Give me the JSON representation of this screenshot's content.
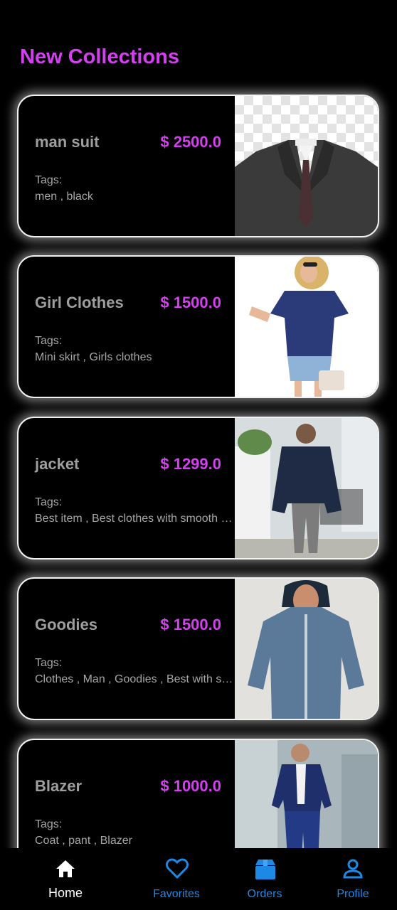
{
  "page": {
    "title": "New Collections",
    "accent_color": "#d43ff0",
    "nav_color": "#1e88e5"
  },
  "products": [
    {
      "name": "man suit",
      "price": "$ 2500.0",
      "tags_label": "Tags:",
      "tags": "men ,  black",
      "image": "suit-on-transparent-photo"
    },
    {
      "name": "Girl Clothes",
      "price": "$ 1500.0",
      "tags_label": "Tags:",
      "tags": "Mini skirt ,  Girls clothes",
      "image": "woman-blue-tee-photo"
    },
    {
      "name": "jacket",
      "price": "$ 1299.0",
      "tags_label": "Tags:",
      "tags": "Best item ,  Best clothes with smooth fabric",
      "image": "man-navy-jacket-photo"
    },
    {
      "name": "Goodies",
      "price": "$ 1500.0",
      "tags_label": "Tags:",
      "tags": "Clothes ,  Man ,  Goodies ,  Best with style",
      "image": "man-blue-hoodie-photo"
    },
    {
      "name": "Blazer",
      "price": "$ 1000.0",
      "tags_label": "Tags:",
      "tags": "Coat ,  pant ,  Blazer",
      "image": "man-blue-blazer-photo"
    }
  ],
  "nav": {
    "items": [
      {
        "label": "Home",
        "icon": "home-icon",
        "active": true
      },
      {
        "label": "Favorites",
        "icon": "heart-icon",
        "active": false
      },
      {
        "label": "Orders",
        "icon": "box-icon",
        "active": false
      },
      {
        "label": "Profile",
        "icon": "person-icon",
        "active": false
      }
    ]
  }
}
